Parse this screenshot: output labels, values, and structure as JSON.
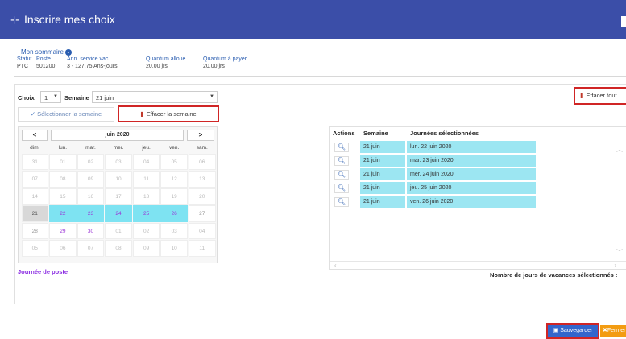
{
  "header": {
    "title": "Inscrire mes choix",
    "icon": "calendar-plus-icon",
    "color": "#3b4ea8"
  },
  "summary": {
    "link": "Mon sommaire",
    "columns": [
      {
        "h": "Statut",
        "v": "PTC"
      },
      {
        "h": "Poste",
        "v": "501200"
      },
      {
        "h": "Ann. service vac.",
        "v": "3 - 127,75 Ans-jours"
      },
      {
        "h": "Quantum alloué",
        "v": "20,00 jrs"
      },
      {
        "h": "Quantum à payer",
        "v": "20,00 jrs"
      }
    ]
  },
  "form": {
    "choix_label": "Choix",
    "choix_value": "1",
    "semaine_label": "Semaine",
    "semaine_value": "21 juin",
    "select_week": "Sélectionner la semaine",
    "clear_week": "Effacer la semaine",
    "clear_all": "Effacer tout"
  },
  "calendar": {
    "prev": "<",
    "next": ">",
    "month": "juin 2020",
    "days": [
      "dim.",
      "lun.",
      "mar.",
      "mer.",
      "jeu.",
      "ven.",
      "sam."
    ],
    "weeks": [
      [
        "31",
        "01",
        "02",
        "03",
        "04",
        "05",
        "06"
      ],
      [
        "07",
        "08",
        "09",
        "10",
        "11",
        "12",
        "13"
      ],
      [
        "14",
        "15",
        "16",
        "17",
        "18",
        "19",
        "20"
      ],
      [
        "21",
        "22",
        "23",
        "24",
        "25",
        "26",
        "27"
      ],
      [
        "28",
        "29",
        "30",
        "01",
        "02",
        "03",
        "04"
      ],
      [
        "05",
        "06",
        "07",
        "08",
        "09",
        "10",
        "11"
      ]
    ],
    "legend": "Journée de poste"
  },
  "table": {
    "headers": [
      "Actions",
      "Semaine",
      "Journées sélectionnées"
    ],
    "rows": [
      {
        "semaine": "21 juin",
        "journee": "lun. 22 juin 2020"
      },
      {
        "semaine": "21 juin",
        "journee": "mar. 23 juin 2020"
      },
      {
        "semaine": "21 juin",
        "journee": "mer. 24 juin 2020"
      },
      {
        "semaine": "21 juin",
        "journee": "jeu. 25 juin 2020"
      },
      {
        "semaine": "21 juin",
        "journee": "ven. 26 juin 2020"
      }
    ],
    "count_label": "Nombre de jours de vacances sélectionnés :"
  },
  "footer": {
    "save": "Sauvegarder",
    "close": "Fermer"
  }
}
